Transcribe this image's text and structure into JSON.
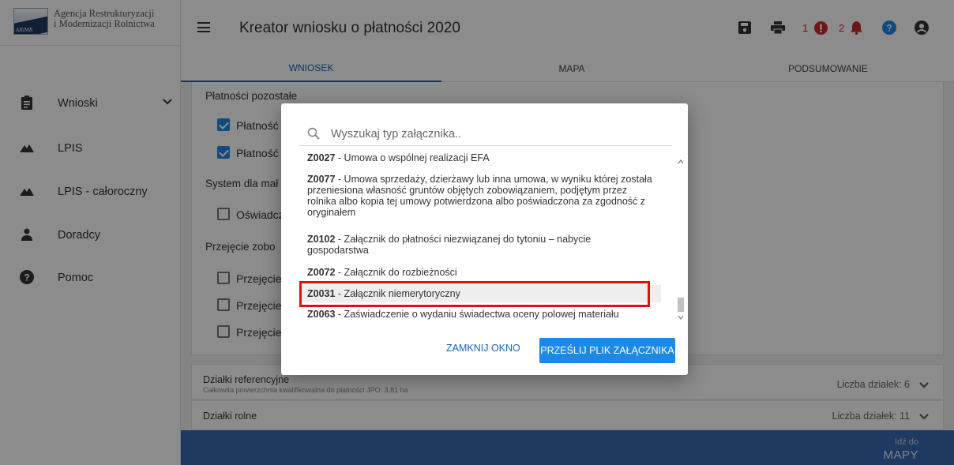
{
  "brand": {
    "agency_line1": "Agencja Restrukturyzacji",
    "agency_line2": "i Modernizacji Rolnictwa",
    "logo_text": "ARiMR"
  },
  "header": {
    "title": "Kreator wniosku o płatności 2020",
    "count_errors": "1",
    "count_alerts": "2"
  },
  "sidebar": {
    "items": [
      {
        "label": "Wnioski",
        "icon": "clipboard-icon"
      },
      {
        "label": "LPIS",
        "icon": "mountain-icon"
      },
      {
        "label": "LPIS - całoroczny",
        "icon": "mountain-icon"
      },
      {
        "label": "Doradcy",
        "icon": "person-icon"
      },
      {
        "label": "Pomoc",
        "icon": "help-icon"
      }
    ]
  },
  "tabs": [
    {
      "label": "WNIOSEK",
      "active": true
    },
    {
      "label": "MAPA",
      "active": false
    },
    {
      "label": "PODSUMOWANIE",
      "active": false
    }
  ],
  "form": {
    "section1_title": "Płatności pozostałe",
    "cb1": "Płatność",
    "cb2": "Płatność",
    "section2_title": "System dla mał",
    "cb3": "Oświadcz",
    "section3_title": "Przejęcie zobo",
    "cb4": "Przejęcie",
    "cb5": "Przejęcie",
    "cb6": "Przejęcie"
  },
  "panels": {
    "p1_title": "Działki referencyjne",
    "p1_sub": "Całkowita powierzchnia kwalifikowalna do płatności JPO: 3,81 ha",
    "p1_right": "Liczba działek: 6",
    "p2_title": "Działki rolne",
    "p2_right": "Liczba działek: 11"
  },
  "footer": {
    "goto_small": "Idź do",
    "goto_big": "MAPY"
  },
  "modal": {
    "search_placeholder": "Wyszukaj typ załącznika..",
    "items": [
      {
        "code": "Z0027",
        "text": " - Umowa o wspólnej realizacji EFA"
      },
      {
        "code": "Z0077",
        "text": " - Umowa sprzedaży, dzierżawy lub inna umowa, w wyniku której została przeniesiona własność gruntów objętych zobowiązaniem, podjętym przez rolnika albo kopia tej umowy potwierdzona albo poświadczona za zgodność z oryginałem"
      },
      {
        "code": "Z0102",
        "text": " - Załącznik do płatności niezwiązanej do tytoniu – nabycie gospodarstwa"
      },
      {
        "code": "Z0072",
        "text": " - Załącznik do rozbieżności"
      },
      {
        "code": "Z0031",
        "text": " - Załącznik niemerytoryczny"
      },
      {
        "code": "Z0063",
        "text": " - Zaświadczenie o wydaniu świadectwa oceny polowej materiału"
      }
    ],
    "close_label": "ZAMKNIJ OKNO",
    "send_label": "PRZEŚLIJ PLIK ZAŁĄCZNIKA"
  }
}
